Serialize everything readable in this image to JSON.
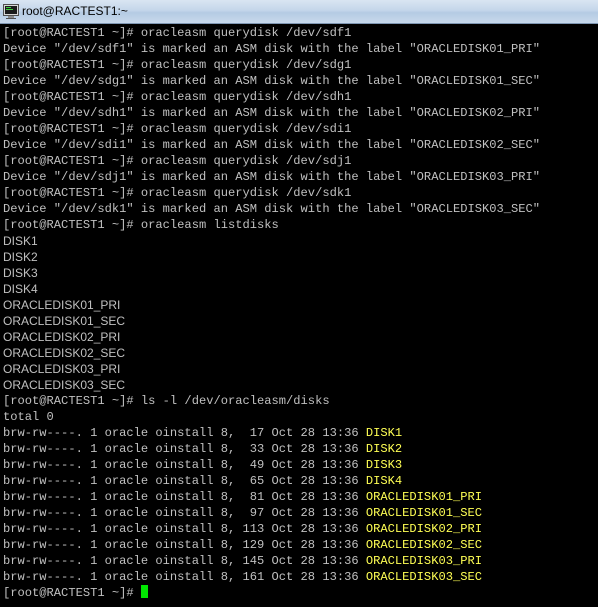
{
  "window": {
    "title": "root@RACTEST1:~"
  },
  "terminal": {
    "icon": "putty-terminal-icon",
    "colors": {
      "background": "#000000",
      "text": "#c0c0c0",
      "highlight": "#ffff54",
      "cursor": "#00e600"
    },
    "query_lines": [
      "[root@RACTEST1 ~]# oracleasm querydisk /dev/sdf1",
      "Device \"/dev/sdf1\" is marked an ASM disk with the label \"ORACLEDISK01_PRI\"",
      "[root@RACTEST1 ~]# oracleasm querydisk /dev/sdg1",
      "Device \"/dev/sdg1\" is marked an ASM disk with the label \"ORACLEDISK01_SEC\"",
      "[root@RACTEST1 ~]# oracleasm querydisk /dev/sdh1",
      "Device \"/dev/sdh1\" is marked an ASM disk with the label \"ORACLEDISK02_PRI\"",
      "[root@RACTEST1 ~]# oracleasm querydisk /dev/sdi1",
      "Device \"/dev/sdi1\" is marked an ASM disk with the label \"ORACLEDISK02_SEC\"",
      "[root@RACTEST1 ~]# oracleasm querydisk /dev/sdj1",
      "Device \"/dev/sdj1\" is marked an ASM disk with the label \"ORACLEDISK03_PRI\"",
      "[root@RACTEST1 ~]# oracleasm querydisk /dev/sdk1",
      "Device \"/dev/sdk1\" is marked an ASM disk with the label \"ORACLEDISK03_SEC\"",
      "[root@RACTEST1 ~]# oracleasm listdisks"
    ],
    "listdisks_output": [
      "DISK1",
      "DISK2",
      "DISK3",
      "DISK4",
      "ORACLEDISK01_PRI",
      "ORACLEDISK01_SEC",
      "ORACLEDISK02_PRI",
      "ORACLEDISK02_SEC",
      "ORACLEDISK03_PRI",
      "ORACLEDISK03_SEC"
    ],
    "ls_command": "[root@RACTEST1 ~]# ls -l /dev/oracleasm/disks",
    "ls_total": "total 0",
    "ls_rows": [
      {
        "prefix": "brw-rw----. 1 oracle oinstall 8,  17 Oct 28 13:36 ",
        "name": "DISK1"
      },
      {
        "prefix": "brw-rw----. 1 oracle oinstall 8,  33 Oct 28 13:36 ",
        "name": "DISK2"
      },
      {
        "prefix": "brw-rw----. 1 oracle oinstall 8,  49 Oct 28 13:36 ",
        "name": "DISK3"
      },
      {
        "prefix": "brw-rw----. 1 oracle oinstall 8,  65 Oct 28 13:36 ",
        "name": "DISK4"
      },
      {
        "prefix": "brw-rw----. 1 oracle oinstall 8,  81 Oct 28 13:36 ",
        "name": "ORACLEDISK01_PRI"
      },
      {
        "prefix": "brw-rw----. 1 oracle oinstall 8,  97 Oct 28 13:36 ",
        "name": "ORACLEDISK01_SEC"
      },
      {
        "prefix": "brw-rw----. 1 oracle oinstall 8, 113 Oct 28 13:36 ",
        "name": "ORACLEDISK02_PRI"
      },
      {
        "prefix": "brw-rw----. 1 oracle oinstall 8, 129 Oct 28 13:36 ",
        "name": "ORACLEDISK02_SEC"
      },
      {
        "prefix": "brw-rw----. 1 oracle oinstall 8, 145 Oct 28 13:36 ",
        "name": "ORACLEDISK03_PRI"
      },
      {
        "prefix": "brw-rw----. 1 oracle oinstall 8, 161 Oct 28 13:36 ",
        "name": "ORACLEDISK03_SEC"
      }
    ],
    "final_prompt": "[root@RACTEST1 ~]# "
  }
}
